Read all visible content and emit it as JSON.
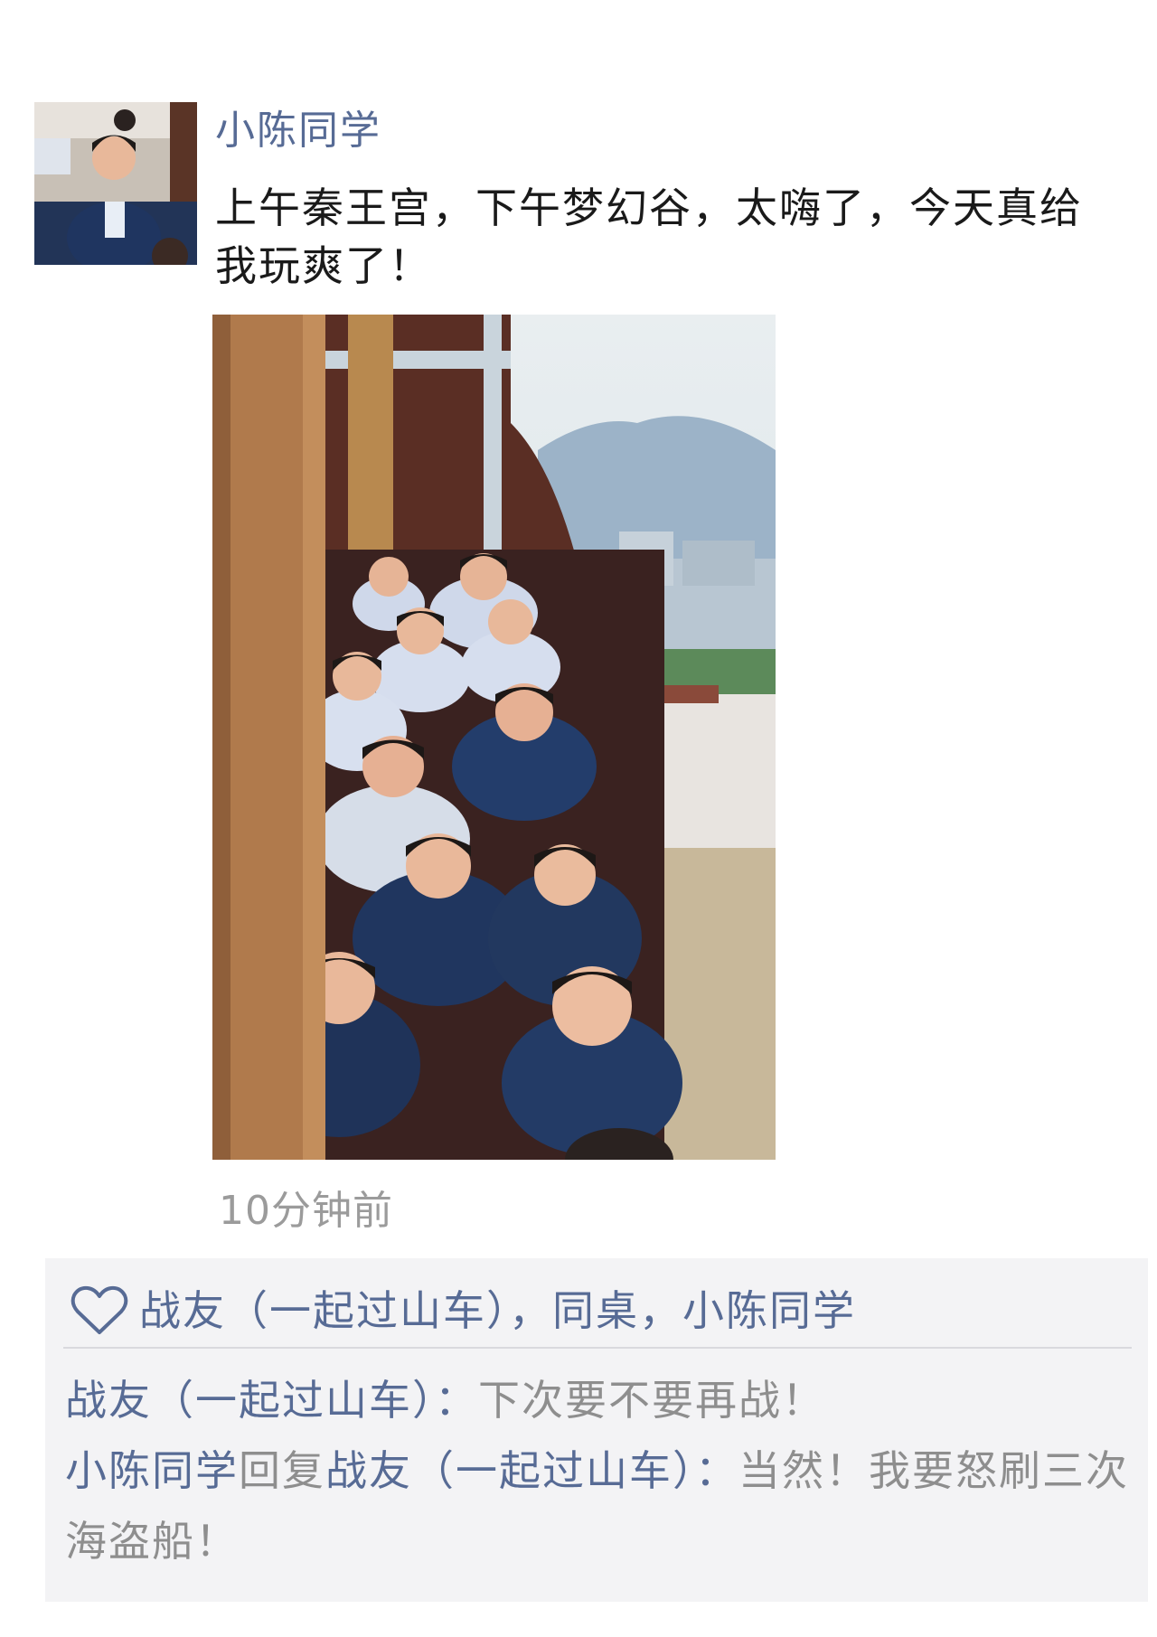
{
  "post": {
    "author": "小陈同学",
    "text": "上午秦王宫，下午梦幻谷，太嗨了，今天真给我玩爽了！",
    "timestamp": "10分钟前"
  },
  "likes": {
    "icon": "heart-outline-icon",
    "text": "战友（一起过山车），同桌，小陈同学"
  },
  "comments": [
    {
      "author": "战友（一起过山车）",
      "separator": "：",
      "text": "下次要不要再战！"
    },
    {
      "author": "小陈同学",
      "reply_word": "回复",
      "reply_to": "战友（一起过山车）",
      "separator": "：",
      "text": "当然！我要怒刷三次海盗船！"
    }
  ],
  "colors": {
    "name_blue": "#576b95",
    "comment_grey": "#8e8e8e",
    "panel_bg": "#f3f3f5"
  }
}
